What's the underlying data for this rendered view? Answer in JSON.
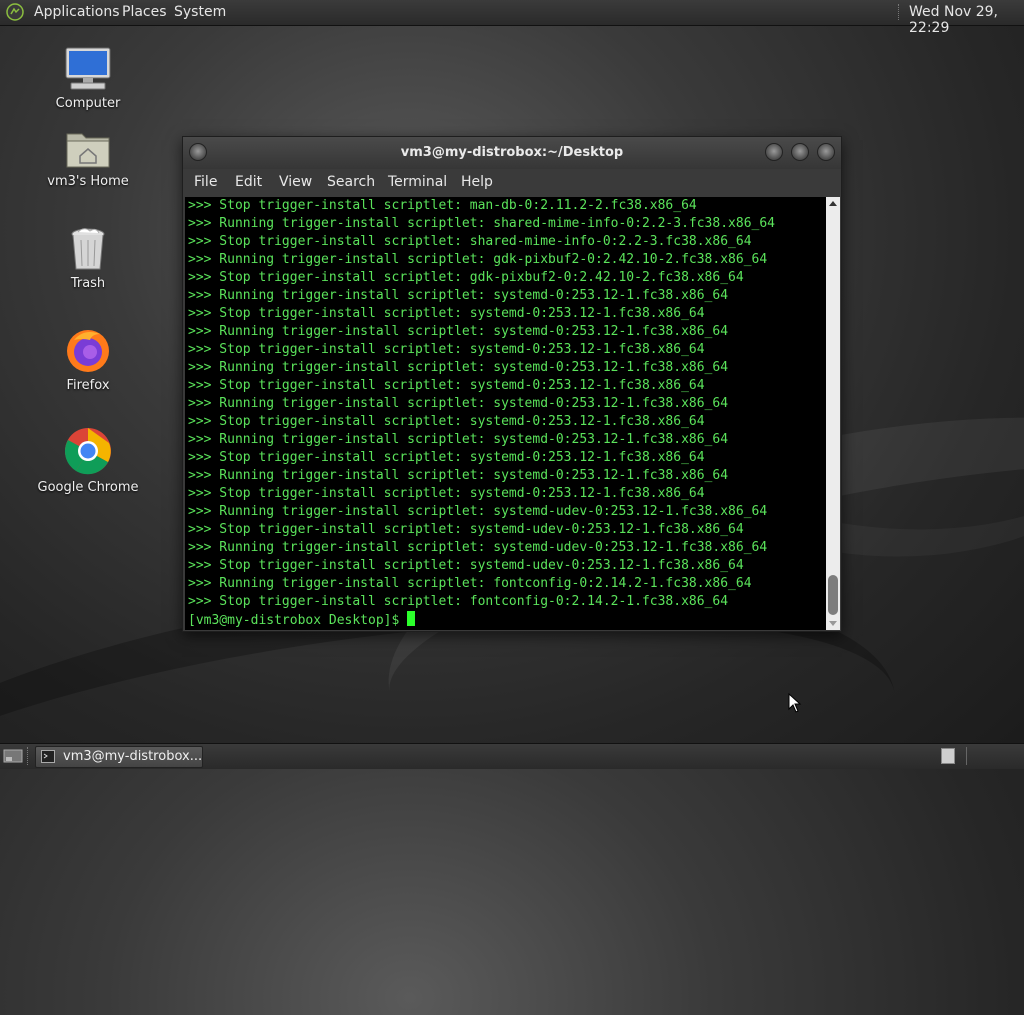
{
  "top_panel": {
    "menus": [
      "Applications",
      "Places",
      "System"
    ],
    "clock": "Wed Nov 29, 22:29"
  },
  "desktop": {
    "icons": [
      {
        "label": "Computer",
        "icon": "computer-icon"
      },
      {
        "label": "vm3's Home",
        "icon": "home-folder-icon"
      },
      {
        "label": "Trash",
        "icon": "trash-icon"
      },
      {
        "label": "Firefox",
        "icon": "firefox-icon"
      },
      {
        "label": "Google Chrome",
        "icon": "chrome-icon"
      }
    ]
  },
  "terminal": {
    "title": "vm3@my-distrobox:~/Desktop",
    "menu": [
      "File",
      "Edit",
      "View",
      "Search",
      "Terminal",
      "Help"
    ],
    "lines": [
      ">>> Stop trigger-install scriptlet: man-db-0:2.11.2-2.fc38.x86_64",
      ">>> Running trigger-install scriptlet: shared-mime-info-0:2.2-3.fc38.x86_64",
      ">>> Stop trigger-install scriptlet: shared-mime-info-0:2.2-3.fc38.x86_64",
      ">>> Running trigger-install scriptlet: gdk-pixbuf2-0:2.42.10-2.fc38.x86_64",
      ">>> Stop trigger-install scriptlet: gdk-pixbuf2-0:2.42.10-2.fc38.x86_64",
      ">>> Running trigger-install scriptlet: systemd-0:253.12-1.fc38.x86_64",
      ">>> Stop trigger-install scriptlet: systemd-0:253.12-1.fc38.x86_64",
      ">>> Running trigger-install scriptlet: systemd-0:253.12-1.fc38.x86_64",
      ">>> Stop trigger-install scriptlet: systemd-0:253.12-1.fc38.x86_64",
      ">>> Running trigger-install scriptlet: systemd-0:253.12-1.fc38.x86_64",
      ">>> Stop trigger-install scriptlet: systemd-0:253.12-1.fc38.x86_64",
      ">>> Running trigger-install scriptlet: systemd-0:253.12-1.fc38.x86_64",
      ">>> Stop trigger-install scriptlet: systemd-0:253.12-1.fc38.x86_64",
      ">>> Running trigger-install scriptlet: systemd-0:253.12-1.fc38.x86_64",
      ">>> Stop trigger-install scriptlet: systemd-0:253.12-1.fc38.x86_64",
      ">>> Running trigger-install scriptlet: systemd-0:253.12-1.fc38.x86_64",
      ">>> Stop trigger-install scriptlet: systemd-0:253.12-1.fc38.x86_64",
      ">>> Running trigger-install scriptlet: systemd-udev-0:253.12-1.fc38.x86_64",
      ">>> Stop trigger-install scriptlet: systemd-udev-0:253.12-1.fc38.x86_64",
      ">>> Running trigger-install scriptlet: systemd-udev-0:253.12-1.fc38.x86_64",
      ">>> Stop trigger-install scriptlet: systemd-udev-0:253.12-1.fc38.x86_64",
      ">>> Running trigger-install scriptlet: fontconfig-0:2.14.2-1.fc38.x86_64",
      ">>> Stop trigger-install scriptlet: fontconfig-0:2.14.2-1.fc38.x86_64"
    ],
    "prompt": "[vm3@my-distrobox Desktop]$ ",
    "text_color": "#5be35b",
    "cursor_color": "#2cff2c"
  },
  "taskbar": {
    "window_button": "vm3@my-distrobox..."
  }
}
